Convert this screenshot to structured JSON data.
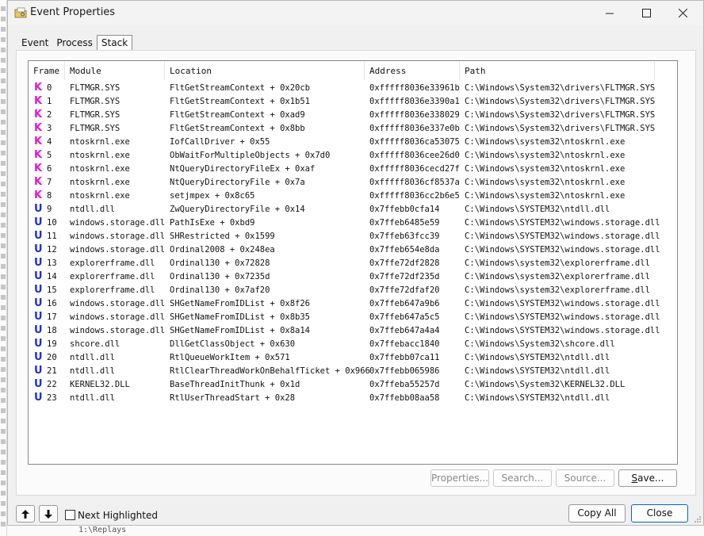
{
  "window": {
    "title": "Event Properties"
  },
  "tabs": [
    {
      "label": "Event"
    },
    {
      "label": "Process"
    },
    {
      "label": "Stack",
      "active": true
    }
  ],
  "table": {
    "columns": [
      "Frame",
      "Module",
      "Location",
      "Address",
      "Path"
    ],
    "rows": [
      {
        "mode": "K",
        "frame": "0",
        "module": "FLTMGR.SYS",
        "location": "FltGetStreamContext + 0x20cb",
        "address": "0xfffff8036e33961b",
        "path": "C:\\Windows\\System32\\drivers\\FLTMGR.SYS"
      },
      {
        "mode": "K",
        "frame": "1",
        "module": "FLTMGR.SYS",
        "location": "FltGetStreamContext + 0x1b51",
        "address": "0xfffff8036e3390a1",
        "path": "C:\\Windows\\System32\\drivers\\FLTMGR.SYS"
      },
      {
        "mode": "K",
        "frame": "2",
        "module": "FLTMGR.SYS",
        "location": "FltGetStreamContext + 0xad9",
        "address": "0xfffff8036e338029",
        "path": "C:\\Windows\\System32\\drivers\\FLTMGR.SYS"
      },
      {
        "mode": "K",
        "frame": "3",
        "module": "FLTMGR.SYS",
        "location": "FltGetStreamContext + 0x8bb",
        "address": "0xfffff8036e337e0b",
        "path": "C:\\Windows\\System32\\drivers\\FLTMGR.SYS"
      },
      {
        "mode": "K",
        "frame": "4",
        "module": "ntoskrnl.exe",
        "location": "IofCallDriver + 0x55",
        "address": "0xfffff8036ca53075",
        "path": "C:\\Windows\\system32\\ntoskrnl.exe"
      },
      {
        "mode": "K",
        "frame": "5",
        "module": "ntoskrnl.exe",
        "location": "ObWaitForMultipleObjects + 0x7d0",
        "address": "0xfffff8036cee26d0",
        "path": "C:\\Windows\\system32\\ntoskrnl.exe"
      },
      {
        "mode": "K",
        "frame": "6",
        "module": "ntoskrnl.exe",
        "location": "NtQueryDirectoryFileEx + 0xaf",
        "address": "0xfffff8036cecd27f",
        "path": "C:\\Windows\\system32\\ntoskrnl.exe"
      },
      {
        "mode": "K",
        "frame": "7",
        "module": "ntoskrnl.exe",
        "location": "NtQueryDirectoryFile + 0x7a",
        "address": "0xfffff8036cf8537a",
        "path": "C:\\Windows\\system32\\ntoskrnl.exe"
      },
      {
        "mode": "K",
        "frame": "8",
        "module": "ntoskrnl.exe",
        "location": "setjmpex + 0x8c65",
        "address": "0xfffff8036cc2b6e5",
        "path": "C:\\Windows\\system32\\ntoskrnl.exe"
      },
      {
        "mode": "U",
        "frame": "9",
        "module": "ntdll.dll",
        "location": "ZwQueryDirectoryFile + 0x14",
        "address": "0x7ffebb0cfa14",
        "path": "C:\\Windows\\SYSTEM32\\ntdll.dll"
      },
      {
        "mode": "U",
        "frame": "10",
        "module": "windows.storage.dll",
        "location": "PathIsExe + 0xbd9",
        "address": "0x7ffeb6485e59",
        "path": "C:\\Windows\\SYSTEM32\\windows.storage.dll"
      },
      {
        "mode": "U",
        "frame": "11",
        "module": "windows.storage.dll",
        "location": "SHRestricted + 0x1599",
        "address": "0x7ffeb63fcc39",
        "path": "C:\\Windows\\SYSTEM32\\windows.storage.dll"
      },
      {
        "mode": "U",
        "frame": "12",
        "module": "windows.storage.dll",
        "location": "Ordinal2008 + 0x248ea",
        "address": "0x7ffeb654e8da",
        "path": "C:\\Windows\\SYSTEM32\\windows.storage.dll"
      },
      {
        "mode": "U",
        "frame": "13",
        "module": "explorerframe.dll",
        "location": "Ordinal130 + 0x72828",
        "address": "0x7ffe72df2828",
        "path": "C:\\Windows\\system32\\explorerframe.dll"
      },
      {
        "mode": "U",
        "frame": "14",
        "module": "explorerframe.dll",
        "location": "Ordinal130 + 0x7235d",
        "address": "0x7ffe72df235d",
        "path": "C:\\Windows\\system32\\explorerframe.dll"
      },
      {
        "mode": "U",
        "frame": "15",
        "module": "explorerframe.dll",
        "location": "Ordinal130 + 0x7af20",
        "address": "0x7ffe72dfaf20",
        "path": "C:\\Windows\\system32\\explorerframe.dll"
      },
      {
        "mode": "U",
        "frame": "16",
        "module": "windows.storage.dll",
        "location": "SHGetNameFromIDList + 0x8f26",
        "address": "0x7ffeb647a9b6",
        "path": "C:\\Windows\\SYSTEM32\\windows.storage.dll"
      },
      {
        "mode": "U",
        "frame": "17",
        "module": "windows.storage.dll",
        "location": "SHGetNameFromIDList + 0x8b35",
        "address": "0x7ffeb647a5c5",
        "path": "C:\\Windows\\SYSTEM32\\windows.storage.dll"
      },
      {
        "mode": "U",
        "frame": "18",
        "module": "windows.storage.dll",
        "location": "SHGetNameFromIDList + 0x8a14",
        "address": "0x7ffeb647a4a4",
        "path": "C:\\Windows\\SYSTEM32\\windows.storage.dll"
      },
      {
        "mode": "U",
        "frame": "19",
        "module": "shcore.dll",
        "location": "DllGetClassObject + 0x630",
        "address": "0x7ffebacc1840",
        "path": "C:\\Windows\\System32\\shcore.dll"
      },
      {
        "mode": "U",
        "frame": "20",
        "module": "ntdll.dll",
        "location": "RtlQueueWorkItem + 0x571",
        "address": "0x7ffebb07ca11",
        "path": "C:\\Windows\\SYSTEM32\\ntdll.dll"
      },
      {
        "mode": "U",
        "frame": "21",
        "module": "ntdll.dll",
        "location": "RtlClearThreadWorkOnBehalfTicket + 0x966",
        "address": "0x7ffebb065986",
        "path": "C:\\Windows\\SYSTEM32\\ntdll.dll"
      },
      {
        "mode": "U",
        "frame": "22",
        "module": "KERNEL32.DLL",
        "location": "BaseThreadInitThunk + 0x1d",
        "address": "0x7ffeba55257d",
        "path": "C:\\Windows\\System32\\KERNEL32.DLL"
      },
      {
        "mode": "U",
        "frame": "23",
        "module": "ntdll.dll",
        "location": "RtlUserThreadStart + 0x28",
        "address": "0x7ffebb08aa58",
        "path": "C:\\Windows\\SYSTEM32\\ntdll.dll"
      }
    ]
  },
  "panel_buttons": {
    "properties": "Properties...",
    "search": "Search...",
    "source": "Source...",
    "save": "Save..."
  },
  "footer": {
    "next_highlighted_label": "Next Highlighted",
    "next_highlighted_checked": false,
    "copy_all": "Copy All",
    "close": "Close"
  },
  "background_window": {
    "text": "1:\\Replays"
  },
  "colors": {
    "kernel_mode": "#e01ad0",
    "user_mode": "#1d2fd4",
    "accent": "#0067c0"
  }
}
